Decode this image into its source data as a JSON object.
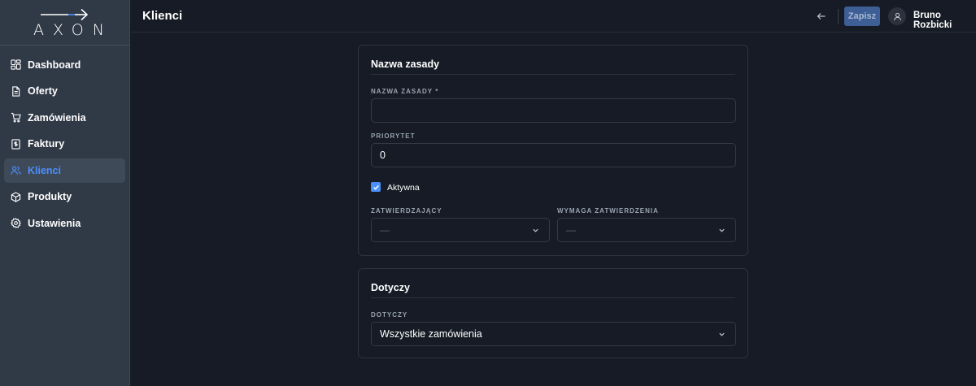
{
  "brand": {
    "logo_text": "AXON"
  },
  "sidebar": {
    "items": [
      {
        "label": "Dashboard",
        "icon": "dashboard-icon"
      },
      {
        "label": "Oferty",
        "icon": "document-icon"
      },
      {
        "label": "Zamówienia",
        "icon": "cart-icon"
      },
      {
        "label": "Faktury",
        "icon": "invoice-icon"
      },
      {
        "label": "Klienci",
        "icon": "users-icon",
        "active": true
      },
      {
        "label": "Produkty",
        "icon": "box-icon"
      },
      {
        "label": "Ustawienia",
        "icon": "gear-icon"
      }
    ]
  },
  "header": {
    "title": "Klienci",
    "save_label": "Zapisz",
    "user_name": "Bruno Rozbicki"
  },
  "rule_card": {
    "title": "Nazwa zasady",
    "name_label": "NAZWA ZASADY *",
    "name_value": "",
    "priority_label": "PRIORYTET",
    "priority_value": "0",
    "active_label": "Aktywna",
    "active_checked": true,
    "approver_label": "ZATWIERDZAJĄCY",
    "approver_value": "—",
    "requires_label": "WYMAGA ZATWIERDZENIA",
    "requires_value": "—"
  },
  "applies_card": {
    "title": "Dotyczy",
    "applies_label": "DOTYCZY",
    "applies_value": "Wszystkie zamówienia"
  },
  "colors": {
    "accent": "#4b90ff",
    "sidebar_bg": "#303946",
    "page_bg": "#161b25",
    "save_button_bg": "#3d5f96"
  }
}
